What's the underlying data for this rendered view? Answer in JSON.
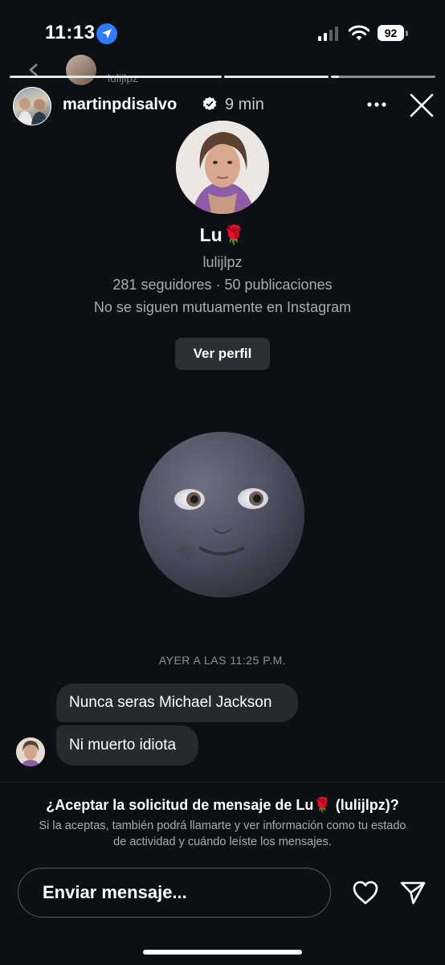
{
  "status_bar": {
    "time": "11:13",
    "battery": "92"
  },
  "peek": {
    "username": "lulijlpz"
  },
  "story": {
    "username": "martinpdisalvo",
    "time_ago": "9 min"
  },
  "profile": {
    "name": "Lu🌹",
    "handle": "lulijlpz",
    "stats": "281 seguidores · 50 publicaciones",
    "mutual": "No se siguen mutuamente en Instagram",
    "view_profile_label": "Ver perfil"
  },
  "conversation": {
    "timestamp": "AYER A LAS 11:25 P.M.",
    "messages": [
      {
        "text": "Nunca seras Michael Jackson"
      },
      {
        "text": "Ni muerto idiota"
      }
    ]
  },
  "request": {
    "title": "¿Aceptar la solicitud de mensaje de Lu🌹 (lulijlpz)?",
    "description": "Si la aceptas, también podrá llamarte y ver información como tu estado de actividad y cuándo leíste los mensajes."
  },
  "composer": {
    "placeholder": "Enviar mensaje..."
  },
  "icons": {
    "location": "location-arrow-icon",
    "signal": "cellular-signal-icon",
    "wifi": "wifi-icon",
    "battery": "battery-icon",
    "verified": "verified-badge-icon",
    "more": "more-options-icon",
    "close": "close-icon",
    "heart": "heart-icon",
    "send": "send-icon"
  },
  "colors": {
    "background": "#0c1014",
    "bubble": "#262a2f",
    "button": "#2b3036",
    "location": "#2f7cf6"
  },
  "story_progress": {
    "segments": 3,
    "current": 3,
    "current_fill": 0.08
  }
}
